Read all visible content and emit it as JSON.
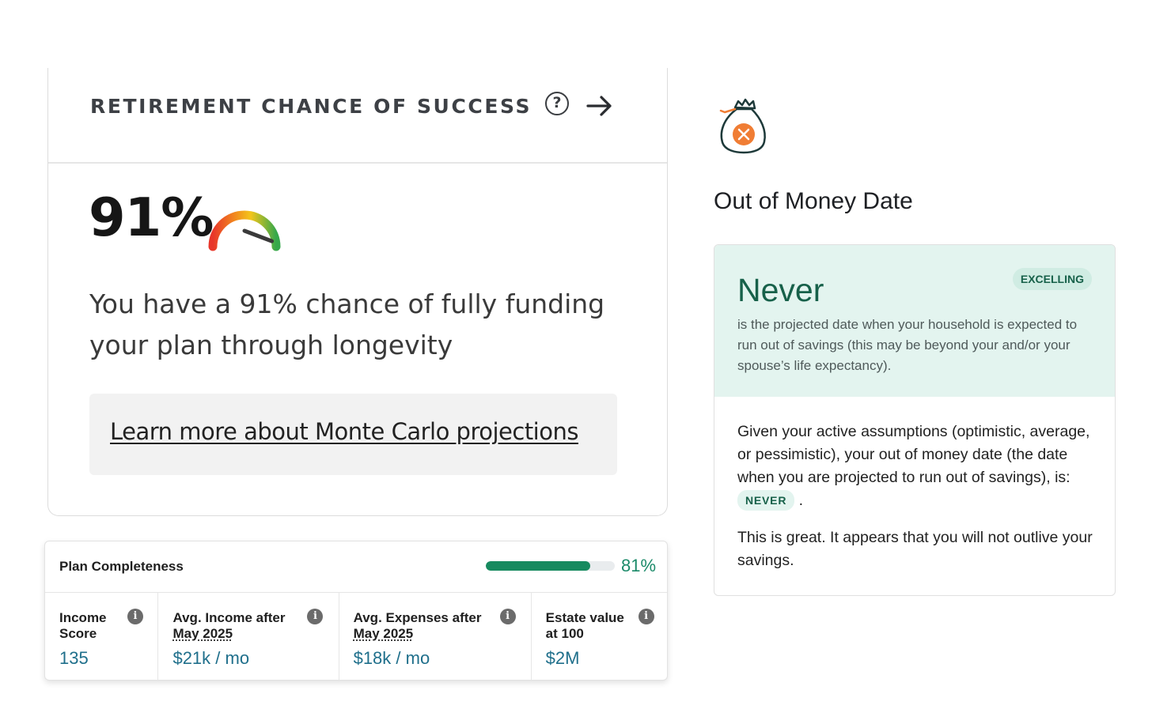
{
  "retirement": {
    "title": "RETIREMENT CHANCE OF SUCCESS",
    "help_icon": "help-circle-icon",
    "arrow_icon": "arrow-right-icon",
    "percent": "91%",
    "gauge_level": 0.91,
    "gauge_icon": "gauge-icon",
    "description": "You have a 91% chance of fully funding your plan through longevity",
    "learn_more_link": "Learn more about Monte Carlo projections"
  },
  "plan": {
    "title": "Plan Completeness",
    "progress": 0.81,
    "progress_text": "81%",
    "metrics": [
      {
        "label_line1": "Income",
        "label_line2": "Score",
        "value": "135"
      },
      {
        "label_line1": "Avg. Income after",
        "label_line2": "May 2025",
        "value": "$21k / mo"
      },
      {
        "label_line1": "Avg. Expenses after",
        "label_line2": "May 2025",
        "value": "$18k / mo"
      },
      {
        "label_line1": "Estate value",
        "label_line2": "at 100",
        "value": "$2M"
      }
    ],
    "info_icon": "info-icon"
  },
  "out_of_money": {
    "icon": "money-bag-icon",
    "title": "Out of Money Date",
    "status": "Never",
    "badge": "EXCELLING",
    "subtitle": "is the projected date when your household is expected to run out of savings (this may be beyond your and/or your spouse’s life expectancy).",
    "body_text": "Given your active assumptions (optimistic, average, or pessimistic), your out of money date (the date when you are projected to run out of savings), is:",
    "inline_badge": "NEVER",
    "body_end": ".",
    "conclusion": "This is great. It appears that you will not outlive your savings."
  },
  "colors": {
    "accent_green": "#178a5f",
    "value_blue": "#1f6f8b",
    "mint_bg": "#e3f4ef"
  }
}
